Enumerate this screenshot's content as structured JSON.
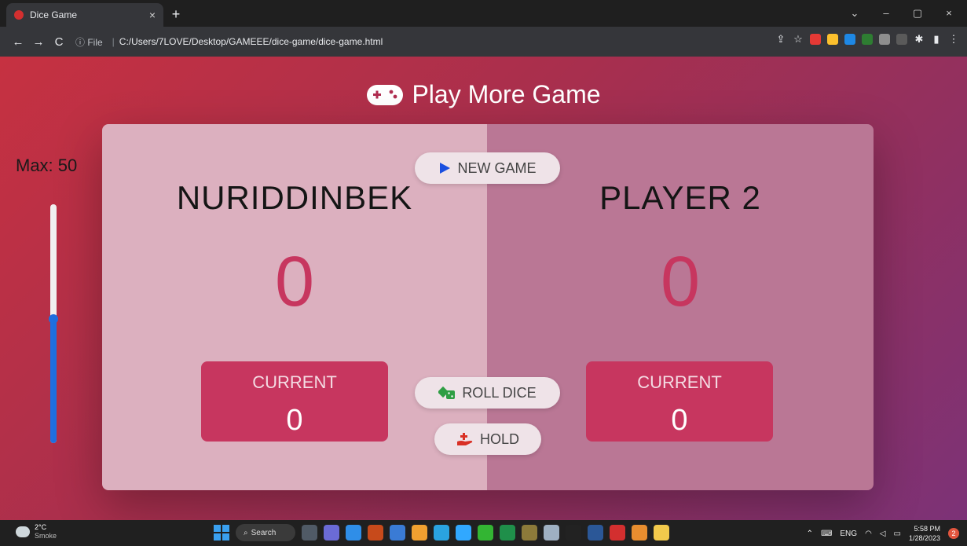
{
  "browser": {
    "tab_title": "Dice Game",
    "tab_close": "×",
    "new_tab": "+",
    "url_info": "ⓘ File",
    "url_separator": "|",
    "url": "C:/Users/7LOVE/Desktop/GAMEEE/dice-game/dice-game.html",
    "nav": {
      "back": "←",
      "forward": "→",
      "reload": "C"
    },
    "window_controls": {
      "collapse": "⌄",
      "minimize": "–",
      "maximize": "▢",
      "close": "×"
    },
    "extension_colors": [
      "#e53935",
      "#fbc02d",
      "#1e88e5",
      "#2e7d32",
      "#8e8e8e",
      "#5a5a5a"
    ]
  },
  "page": {
    "header_text": "Play More Game",
    "max_label": "Max: 50",
    "slider_level_percent": 52,
    "colors": {
      "accent": "#c7365f",
      "slider": "#1f6fe0"
    }
  },
  "players": [
    {
      "name": "NURIDDINBEK",
      "score": "0",
      "current_label": "CURRENT",
      "current_score": "0"
    },
    {
      "name": "PLAYER 2",
      "score": "0",
      "current_label": "CURRENT",
      "current_score": "0"
    }
  ],
  "buttons": {
    "new_game": "NEW GAME",
    "roll_dice": "ROLL DICE",
    "hold": "HOLD"
  },
  "taskbar": {
    "weather_temp": "2°C",
    "weather_desc": "Smoke",
    "search": "Search",
    "app_colors": [
      "#505a66",
      "#6b6bd6",
      "#2f8ee8",
      "#c74a1b",
      "#3a7bd5",
      "#f0a030",
      "#2aa3e0",
      "#31a8ff",
      "#33b533",
      "#1f8f4a",
      "#8c7a3a",
      "#9fb0c2",
      "#222222",
      "#2b5797",
      "#d32f2f",
      "#e88d2f",
      "#f2c94c"
    ],
    "lang": "ENG",
    "time": "5:58 PM",
    "date": "1/28/2023",
    "notifications": "2"
  }
}
